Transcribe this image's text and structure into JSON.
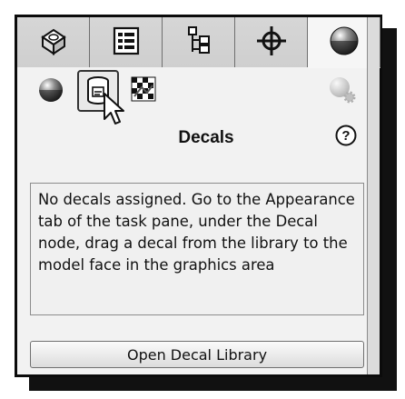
{
  "tabs": [
    {
      "id": "part",
      "icon": "part-icon"
    },
    {
      "id": "properties",
      "icon": "property-list-icon"
    },
    {
      "id": "configuration",
      "icon": "configuration-tree-icon"
    },
    {
      "id": "dimxpert",
      "icon": "crosshair-icon"
    },
    {
      "id": "appearances",
      "icon": "appearance-sphere-icon",
      "active": true
    }
  ],
  "toolbar": {
    "icons": [
      "appearance-sphere-icon",
      "decal-cylinder-icon",
      "scene-checker-icon",
      "gear-settings-icon"
    ]
  },
  "panel": {
    "title": "Decals",
    "help_icon": "help-icon",
    "message": "No decals assigned. Go to the Appearance tab of the task pane, under the Decal node, drag a decal from the library to the model face in the graphics area",
    "button_label": "Open Decal Library"
  },
  "colors": {
    "panel_bg": "#f2f2f2",
    "tab_bg": "#dcdcdc",
    "border": "#0b0b0b"
  }
}
